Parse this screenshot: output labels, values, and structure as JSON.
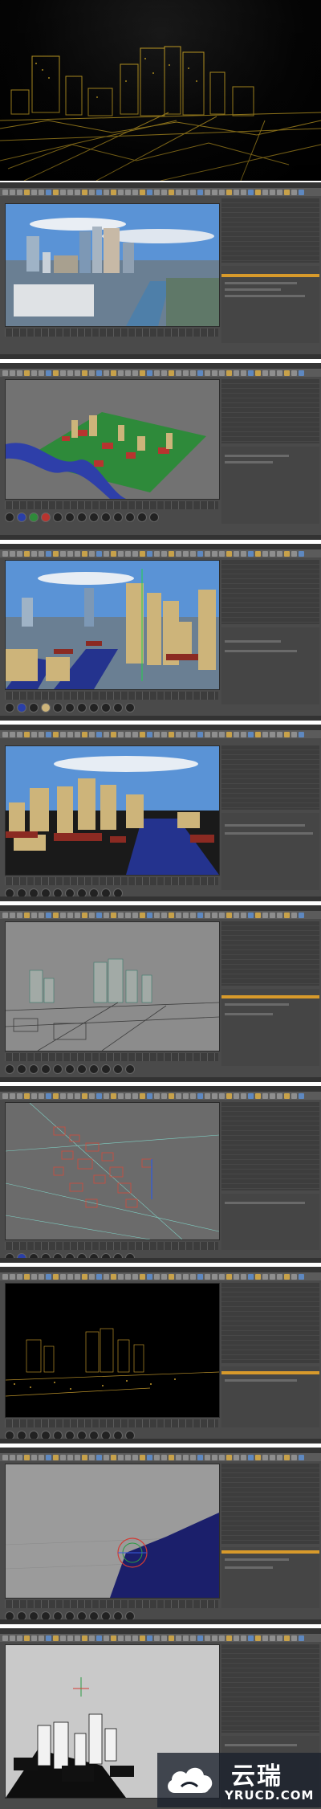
{
  "hero": {
    "theme_color": "#e4b92a"
  },
  "panels": [
    {
      "id": "photo-reference",
      "viewport_style": "photo"
    },
    {
      "id": "city-model-topdown",
      "viewport_style": "green-model"
    },
    {
      "id": "camera-match-overlay",
      "viewport_style": "overlay"
    },
    {
      "id": "render-overlay-2",
      "viewport_style": "overlay2"
    },
    {
      "id": "grey-wireframe-view",
      "viewport_style": "grey"
    },
    {
      "id": "red-wire-spline",
      "viewport_style": "redwire"
    },
    {
      "id": "night-gold-lights",
      "viewport_style": "night"
    },
    {
      "id": "camera-rig-river",
      "viewport_style": "rig"
    },
    {
      "id": "black-white-clay",
      "viewport_style": "bw"
    }
  ],
  "watermark": {
    "brand_cn": "云瑞",
    "domain": "YRUCD.COM",
    "icon": "cloud-logo-icon"
  }
}
